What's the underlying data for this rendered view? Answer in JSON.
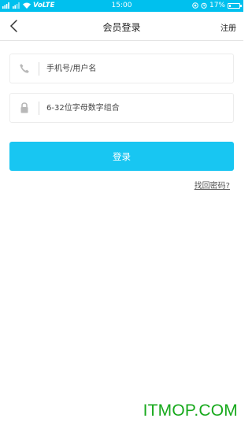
{
  "status_bar": {
    "signal_text": "ıl 4G ıl",
    "volte": "VoLTE",
    "time": "15:00",
    "battery_percent": "17%",
    "battery_level": 0.17
  },
  "nav": {
    "back_icon": "chevron-left-icon",
    "title": "会员登录",
    "register_label": "注册"
  },
  "form": {
    "username": {
      "icon": "phone-icon",
      "placeholder": "手机号/用户名",
      "value": ""
    },
    "password": {
      "icon": "lock-icon",
      "placeholder": "6-32位字母数字组合",
      "value": ""
    },
    "login_label": "登录",
    "forgot_label": "找回密码?"
  },
  "watermark": "ITMOP.COM",
  "colors": {
    "status_bar": "#00c0ee",
    "login_button": "#18c6f2",
    "watermark": "#17a91c"
  }
}
